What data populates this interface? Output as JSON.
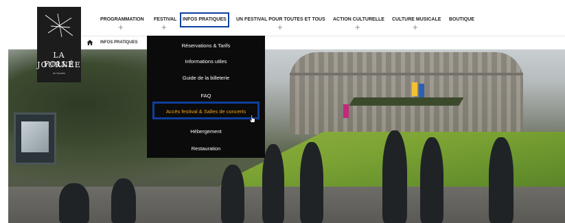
{
  "logo": {
    "line1": "LA FOLLE",
    "line2": "JOURNÉE",
    "line3": "de Nantes"
  },
  "nav": {
    "items": [
      {
        "label": "PROGRAMMATION",
        "has_plus": true
      },
      {
        "label": "FESTIVAL",
        "has_plus": true
      },
      {
        "label": "INFOS PRATIQUES",
        "has_plus": false,
        "active": true
      },
      {
        "label": "UN FESTIVAL POUR TOUTES ET TOUS",
        "has_plus": true
      },
      {
        "label": "ACTION CULTURELLE",
        "has_plus": true
      },
      {
        "label": "CULTURE MUSICALE",
        "has_plus": true
      },
      {
        "label": "BOUTIQUE",
        "has_plus": false
      }
    ],
    "plus_glyph": "+"
  },
  "breadcrumb": {
    "home_icon": "home-icon",
    "current": "INFOS PRATIQUES"
  },
  "dropdown": {
    "items": [
      {
        "label": "Réservations & Tarifs"
      },
      {
        "label": "Informations utiles"
      },
      {
        "label": "Guide de la billeterie"
      },
      {
        "label": "FAQ"
      },
      {
        "label": "Accès festival & Salles de concerts",
        "active": true
      },
      {
        "label": "Hébergement"
      },
      {
        "label": "Restauration"
      }
    ]
  },
  "colors": {
    "highlight_border": "#0f3f9f",
    "dropdown_bg": "#0b0b0b",
    "dropdown_active": "#f2a21a"
  }
}
